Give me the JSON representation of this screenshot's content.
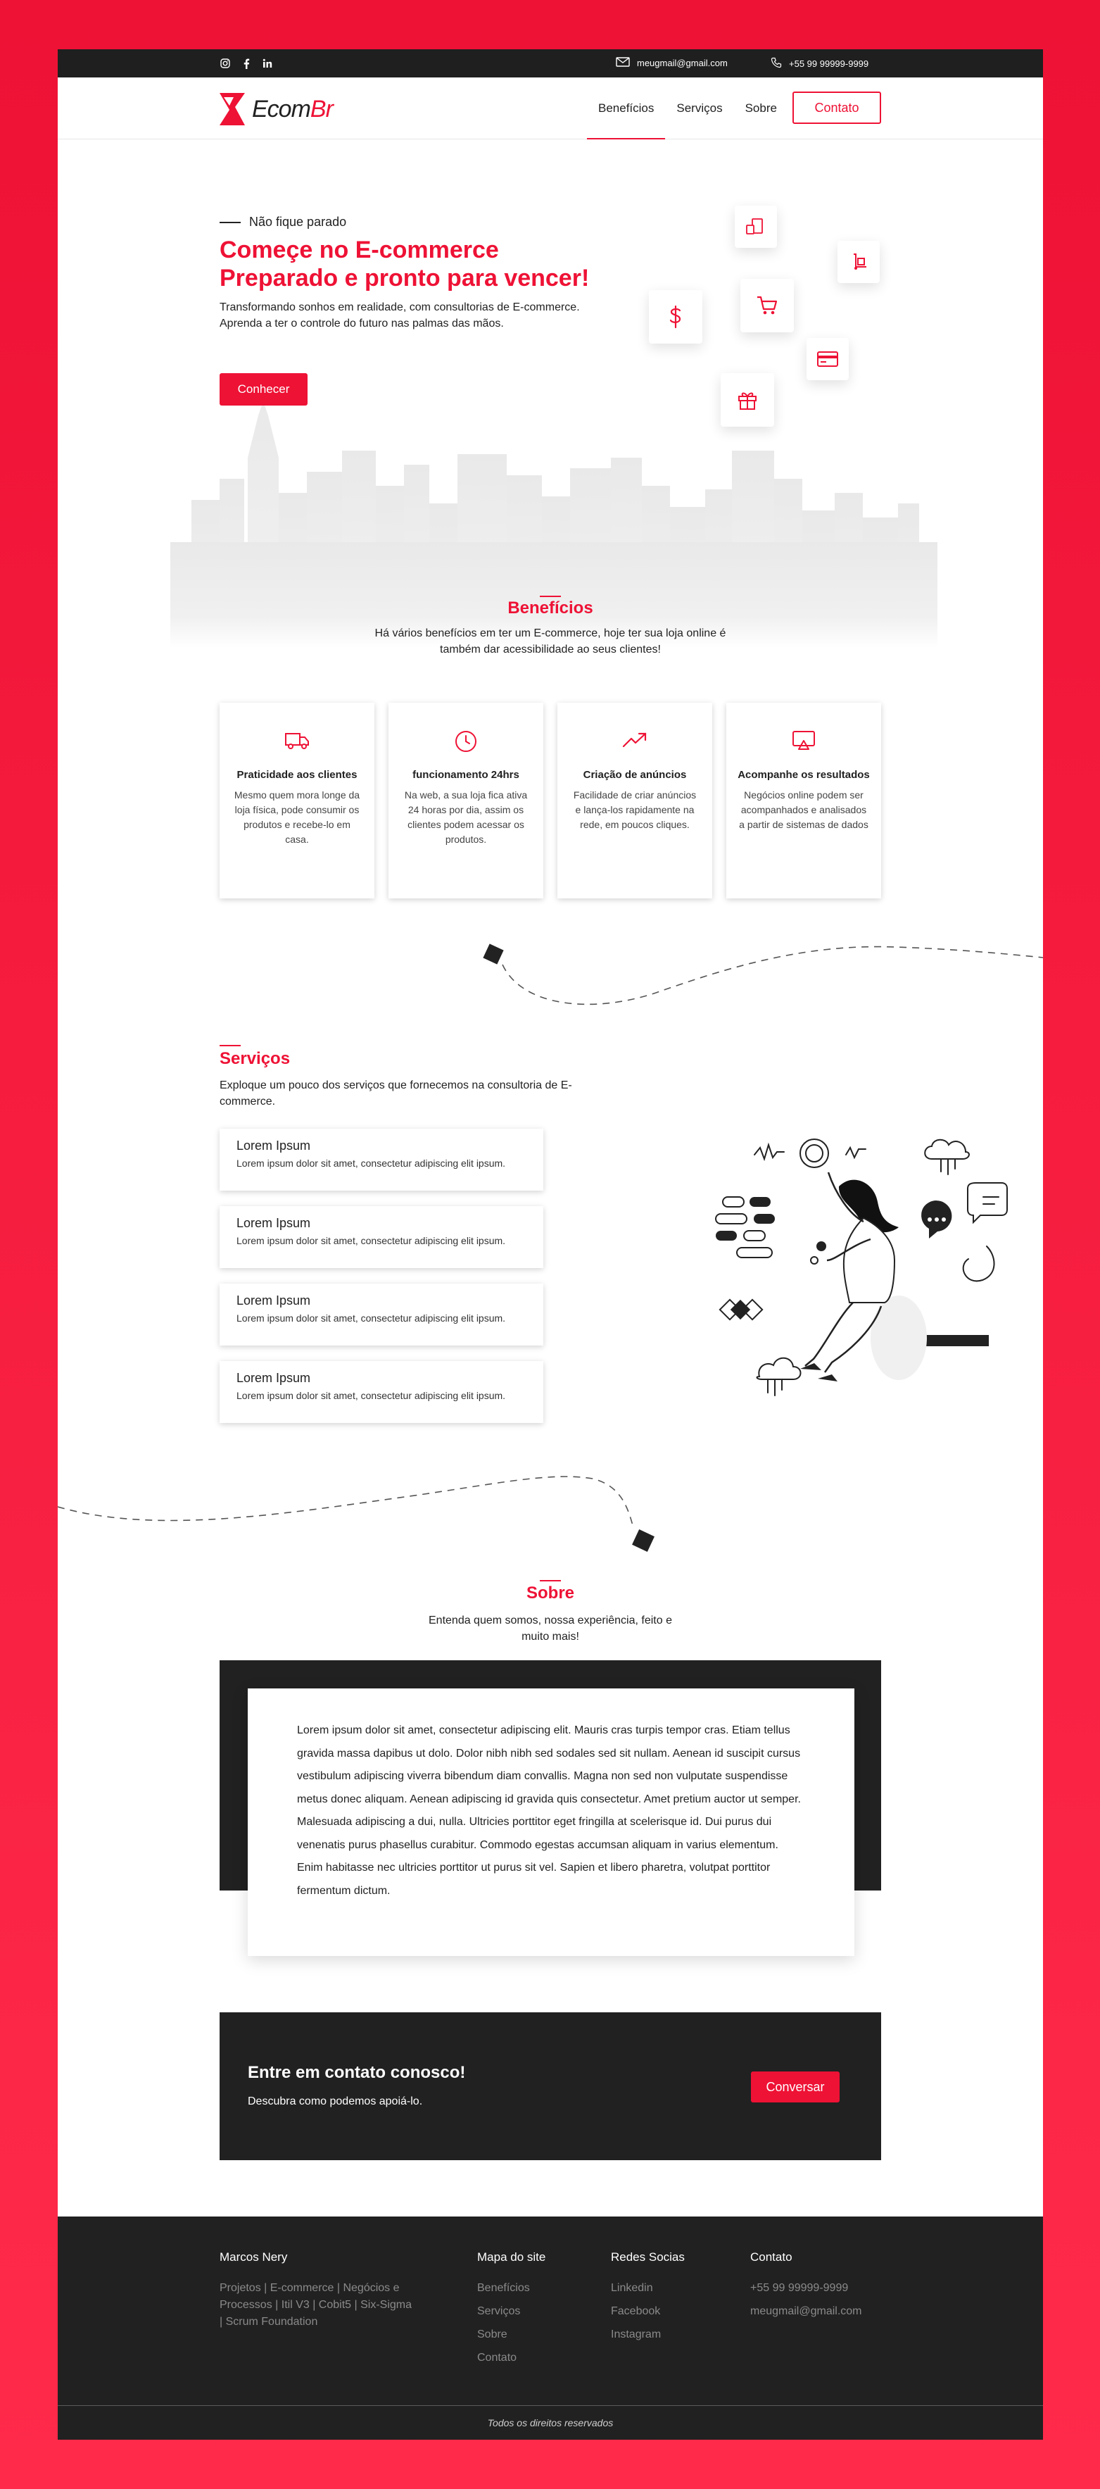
{
  "topbar": {
    "social_icons": [
      "instagram-icon",
      "facebook-icon",
      "linkedin-icon"
    ],
    "email": "meugmail@gmail.com",
    "phone": "+55 99 99999-9999"
  },
  "brand": {
    "logo_main": "Ecom",
    "logo_accent": "Br"
  },
  "nav": {
    "links": [
      "Benefícios",
      "Serviços",
      "Sobre"
    ],
    "active": "Benefícios",
    "contact_button": "Contato"
  },
  "hero": {
    "kicker": "Não fique parado",
    "title_line1": "Começe no E-commerce",
    "title_line2": "Preparado e pronto para vencer!",
    "description": "Transformando sonhos em realidade, com consultorias de E-commerce. Aprenda a ter o controle do futuro nas palmas das mãos.",
    "button": "Conhecer",
    "floating_icons": [
      "phone-icon",
      "hand-truck-icon",
      "dollar-icon",
      "cart-icon",
      "credit-card-icon",
      "gift-icon"
    ]
  },
  "benefits": {
    "title": "Benefícios",
    "subtitle": "Há vários benefícios em ter um E-commerce, hoje ter sua loja online é também dar acessibilidade ao seus clientes!",
    "cards": [
      {
        "icon": "truck-icon",
        "title": "Praticidade aos clientes",
        "text": "Mesmo quem mora longe da loja física, pode consumir os produtos e recebe-lo em casa."
      },
      {
        "icon": "clock-icon",
        "title": "funcionamento 24hrs",
        "text": "Na web, a sua loja fica ativa 24 horas por dia, assim os clientes podem acessar os produtos."
      },
      {
        "icon": "trending-up-icon",
        "title": "Criação de anúncios",
        "text": "Facilidade de criar anúncios e lança-los rapidamente na rede, em poucos cliques."
      },
      {
        "icon": "monitor-icon",
        "title": "Acompanhe os resultados",
        "text": "Negócios online podem ser acompanhados e analisados a partir de sistemas de dados"
      }
    ]
  },
  "services": {
    "title": "Serviços",
    "description": "Exploque um pouco dos serviços que fornecemos na consultoria de E-commerce.",
    "items": [
      {
        "title": "Lorem Ipsum",
        "text": "Lorem ipsum dolor sit amet, consectetur adipiscing elit ipsum."
      },
      {
        "title": "Lorem Ipsum",
        "text": "Lorem ipsum dolor sit amet, consectetur adipiscing elit ipsum."
      },
      {
        "title": "Lorem Ipsum",
        "text": "Lorem ipsum dolor sit amet, consectetur adipiscing elit ipsum."
      },
      {
        "title": "Lorem Ipsum",
        "text": "Lorem ipsum dolor sit amet, consectetur adipiscing elit ipsum."
      }
    ]
  },
  "about": {
    "title": "Sobre",
    "subtitle": "Entenda quem somos, nossa experiência, feito e muito mais!",
    "body": "Lorem ipsum dolor sit amet, consectetur adipiscing elit. Mauris cras turpis tempor cras. Etiam tellus gravida massa dapibus ut dolo. Dolor nibh nibh sed sodales sed sit nullam. Aenean id suscipit cursus vestibulum adipiscing viverra bibendum diam convallis. Magna non sed non vulputate suspendisse metus donec aliquam. Aenean adipiscing id gravida quis consectetur. Amet pretium auctor ut semper. Malesuada adipiscing a dui, nulla. Ultricies porttitor eget fringilla at scelerisque id. Dui purus dui venenatis purus phasellus curabitur. Commodo egestas accumsan aliquam in varius elementum. Enim habitasse nec ultricies porttitor ut purus sit vel. Sapien et libero pharetra, volutpat porttitor fermentum dictum."
  },
  "cta": {
    "title": "Entre em contato conosco!",
    "subtitle": "Descubra como podemos apoiá-lo.",
    "button": "Conversar"
  },
  "footer": {
    "about_title": "Marcos Nery",
    "about_text": "Projetos | E-commerce | Negócios e Processos | Itil V3 | Cobit5 | Six-Sigma | Scrum Foundation",
    "sitemap_title": "Mapa do site",
    "sitemap": [
      "Benefícios",
      "Serviços",
      "Sobre",
      "Contato"
    ],
    "social_title": "Redes Socias",
    "social": [
      "Linkedin",
      "Facebook",
      "Instagram"
    ],
    "contact_title": "Contato",
    "contact": [
      "+55 99 99999-9999",
      "meugmail@gmail.com"
    ],
    "copyright": "Todos os direitos reservados"
  },
  "colors": {
    "accent": "#ee1235",
    "dark": "#212121",
    "frame": "#ffffff"
  }
}
